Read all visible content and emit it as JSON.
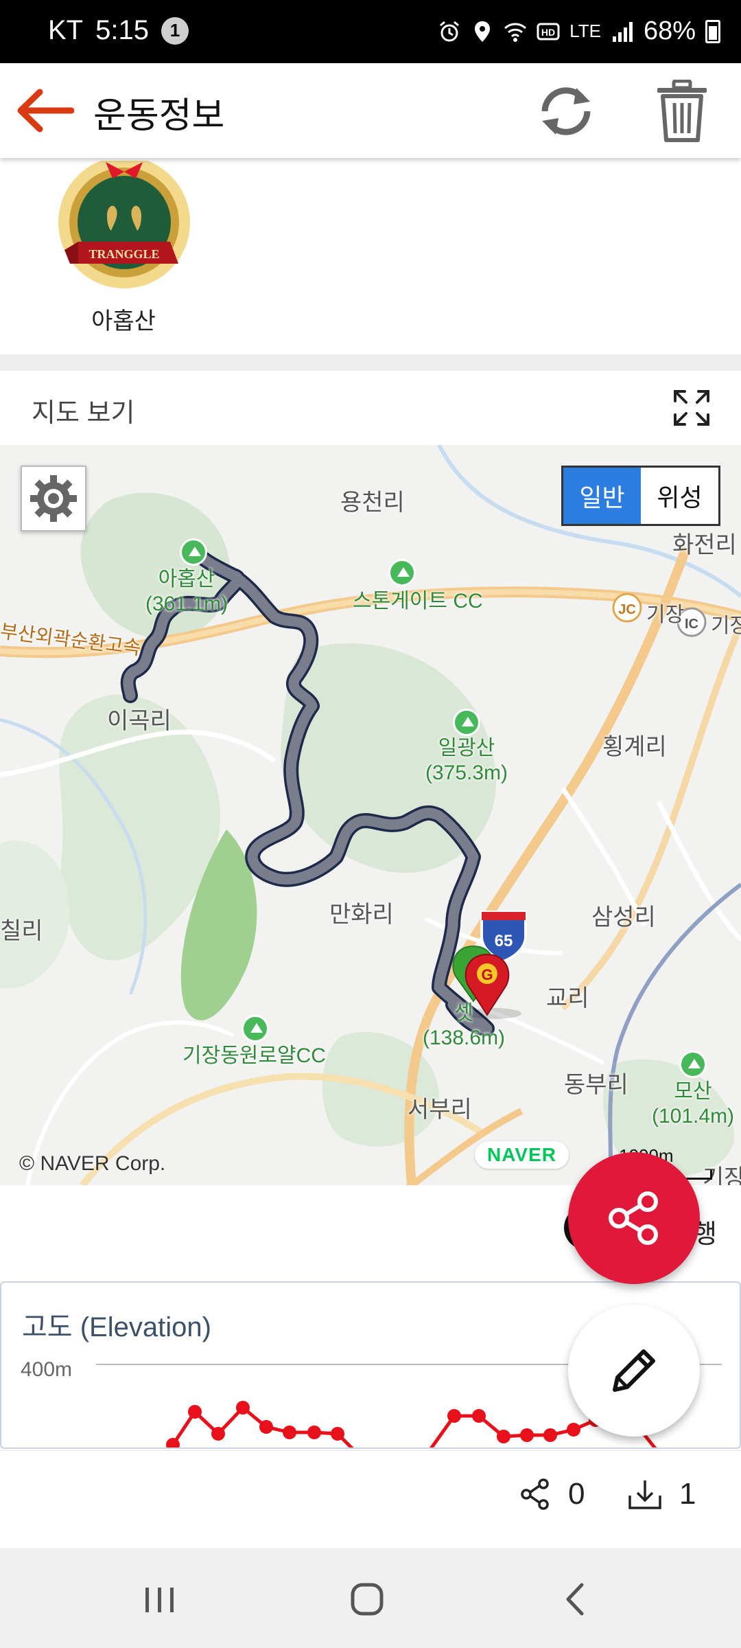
{
  "status_bar": {
    "carrier": "KT",
    "time": "5:15",
    "notification_count": "1",
    "network": "LTE",
    "battery": "68%"
  },
  "app_bar": {
    "title": "운동정보",
    "icons": [
      "back-arrow-icon",
      "refresh-icon",
      "trash-icon"
    ]
  },
  "badge": {
    "brand_text": "TRANGGLE",
    "label": "아홉산"
  },
  "map_section": {
    "header_label": "지도 보기",
    "map_type_options": [
      "일반",
      "위성"
    ],
    "map_type_selected": "일반",
    "places": [
      "용천리",
      "이곡리",
      "횡계리",
      "삼성리",
      "만화리",
      "교리",
      "동부리",
      "서부리",
      "기장",
      "기장",
      "화전리",
      "칠리",
      "기장천"
    ],
    "peaks": [
      {
        "name": "아홉산",
        "elevation": "(361.1m)"
      },
      {
        "name": "일광산",
        "elevation": "(375.3m)"
      },
      {
        "name": "셋",
        "elevation": "(138.6m)"
      },
      {
        "name": "모산",
        "elevation": "(101.4m)"
      }
    ],
    "golf": [
      "스톤게이트 CC",
      "기장동원로얄CC"
    ],
    "road_name": "부산외곽순환고속",
    "highway_number": "65",
    "junctions": [
      "JC",
      "IC"
    ],
    "copyright": "© NAVER Corp.",
    "naver_logo": "NAVER",
    "scale": "1000m",
    "end_marker": "G"
  },
  "route_toggle_text": "행",
  "elevation_chart": {
    "title": "고도 (Elevation)",
    "y_label": "400m"
  },
  "bottom_stats": {
    "share_count": "0",
    "download_count": "1"
  },
  "colors": {
    "accent_red": "#e0183a",
    "back_arrow": "#d83a12",
    "map_type_active": "#2d7de0",
    "route_line": "#7a7d8c",
    "elevation_line": "#e8101a"
  }
}
